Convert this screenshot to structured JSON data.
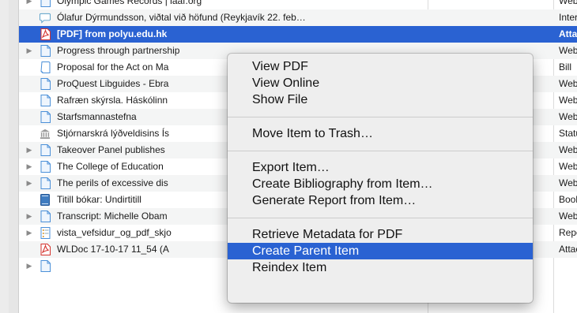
{
  "rows": [
    {
      "title": "Olympic Games Records | iaaf.org",
      "type": "Web",
      "icon": "page-icon",
      "expandable": true
    },
    {
      "title": "Ólafur Dýrmundsson, viðtal við höfund (Reykjavík 22. feb…",
      "type": "Interv",
      "icon": "speech-bubble-icon",
      "expandable": false
    },
    {
      "title": "[PDF] from polyu.edu.hk",
      "type": "Attac",
      "icon": "pdf-icon",
      "expandable": false,
      "selected": true
    },
    {
      "title": "Progress through partnership",
      "type": "Web",
      "icon": "page-icon",
      "expandable": true
    },
    {
      "title": "Proposal for the Act on Ma",
      "type": "Bill",
      "icon": "bill-icon",
      "expandable": false
    },
    {
      "title": "ProQuest Libguides - Ebra",
      "type": "Web",
      "icon": "page-icon",
      "expandable": false
    },
    {
      "title": "Rafræn skýrsla. Háskólinn",
      "type": "Web",
      "icon": "page-icon",
      "expandable": false
    },
    {
      "title": "Starfsmannastefna",
      "type": "Web",
      "icon": "page-icon",
      "expandable": false
    },
    {
      "title": "Stjórnarskrá lýðveldisins Ís",
      "type": "Statu",
      "icon": "statute-icon",
      "expandable": false
    },
    {
      "title": "Takeover Panel publishes",
      "type": "Web",
      "icon": "page-icon",
      "expandable": true
    },
    {
      "title": "The College of Education",
      "type": "Web",
      "icon": "page-icon",
      "expandable": true
    },
    {
      "title": "The perils of excessive dis",
      "type": "Web",
      "icon": "page-icon",
      "expandable": true
    },
    {
      "title": "Titill bókar: Undirtitill",
      "type": "Book",
      "icon": "book-icon",
      "expandable": false
    },
    {
      "title": "Transcript: Michelle Obam",
      "type": "Web",
      "icon": "page-icon",
      "expandable": true
    },
    {
      "title": "vista_vefsidur_og_pdf_skjo",
      "type": "Repo",
      "icon": "report-icon",
      "expandable": true
    },
    {
      "title": "WLDoc  17-10-17 11_54 (A",
      "type": "Attac",
      "icon": "pdf-icon",
      "expandable": false
    },
    {
      "title": "",
      "type": "",
      "icon": "page-icon",
      "expandable": true
    }
  ],
  "menu": {
    "groups": [
      [
        "View PDF",
        "View Online",
        "Show File"
      ],
      [
        "Move Item to Trash…"
      ],
      [
        "Export Item…",
        "Create Bibliography from Item…",
        "Generate Report from Item…"
      ],
      [
        "Retrieve Metadata for PDF",
        "Create Parent Item",
        "Reindex Item"
      ]
    ],
    "highlighted": "Create Parent Item"
  },
  "colors": {
    "selection": "#2a62d2",
    "pdf": "#d4322c"
  }
}
